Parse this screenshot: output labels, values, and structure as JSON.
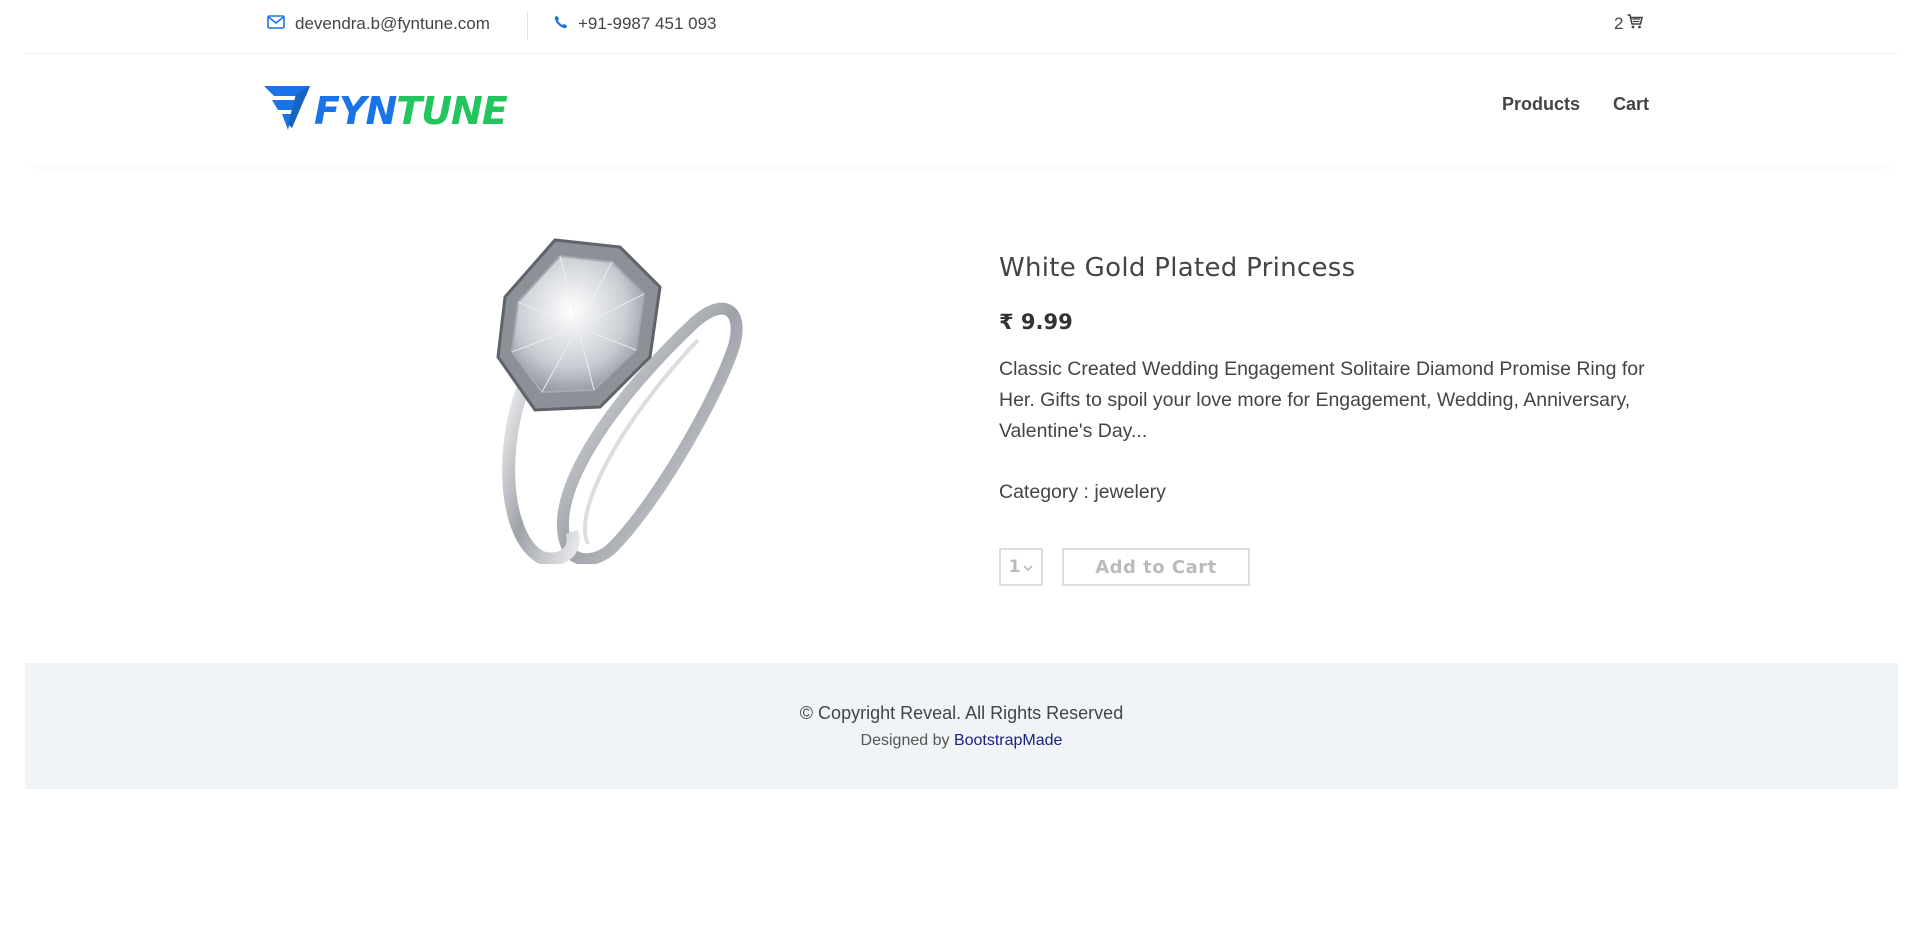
{
  "topbar": {
    "email": "devendra.b@fyntune.com",
    "phone": "+91-9987 451 093",
    "cart_count": "2"
  },
  "header": {
    "logo_text_1": "FYN",
    "logo_text_2": "TUNE",
    "nav": {
      "products": "Products",
      "cart": "Cart"
    }
  },
  "product": {
    "title": "White Gold Plated Princess",
    "price": "₹ 9.99",
    "description": "Classic Created Wedding Engagement Solitaire Diamond Promise Ring for Her. Gifts to spoil your love more for Engagement, Wedding, Anniversary, Valentine's Day...",
    "category": "Category : jewelery",
    "quantity": "1",
    "add_to_cart_label": "Add to Cart"
  },
  "footer": {
    "copyright": "© Copyright Reveal. All Rights Reserved",
    "designed_by": "Designed by",
    "designer_link": "BootstrapMade"
  },
  "colors": {
    "brand_blue": "#1a73e8",
    "brand_green": "#22c55e",
    "footer_bg": "#f0f4f7",
    "link_navy": "#1a237e"
  },
  "icons": [
    "envelope-icon",
    "phone-icon",
    "cart-icon",
    "chevron-down-icon",
    "logo-mark"
  ]
}
